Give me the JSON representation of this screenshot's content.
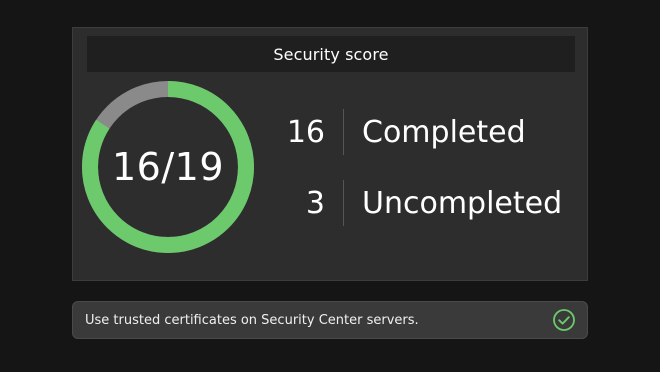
{
  "score_card": {
    "title": "Security score",
    "completed_count": "16",
    "completed_label": "Completed",
    "uncompleted_count": "3",
    "uncompleted_label": "Uncompleted",
    "score_text": "16/19",
    "score_completed": 16,
    "score_total": 19,
    "colors": {
      "completed_arc": "#6cc96c",
      "remaining_arc": "#8a8a8a"
    }
  },
  "tip": {
    "text": "Use trusted certificates on Security Center servers.",
    "icon": "check-circle-icon",
    "icon_color": "#6cc96c"
  }
}
